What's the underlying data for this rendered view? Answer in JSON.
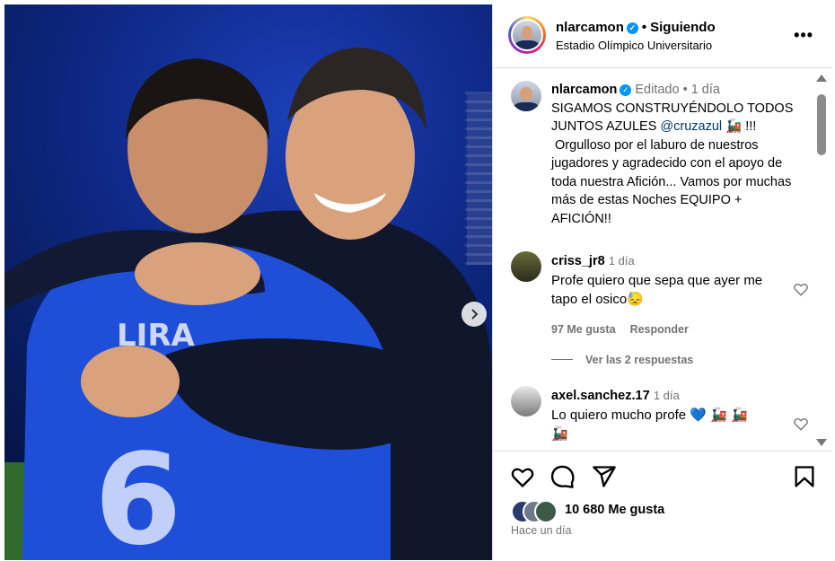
{
  "header": {
    "username": "nlarcamon",
    "follow_status": "Siguiendo",
    "location": "Estadio Olímpico Universitario",
    "more_label": "•••"
  },
  "caption": {
    "username": "nlarcamon",
    "edited": "Editado",
    "time": "1 día",
    "text_before_mention": "SIGAMOS CONSTRUYÉNDOLO TODOS JUNTOS AZULES ",
    "mention": "@cruzazul",
    "text_after_mention": " 🚂 !!!  Orgulloso por el laburo de nuestros jugadores y agradecido con el apoyo de toda nuestra Afición... Vamos por muchas más de estas Noches EQUIPO + AFICIÓN!!"
  },
  "comments": [
    {
      "username": "criss_jr8",
      "time": "1 día",
      "text": "Profe quiero que sepa que ayer me tapo el osico😓",
      "likes": "97 Me gusta",
      "reply_label": "Responder",
      "view_replies": "Ver las 2 respuestas"
    },
    {
      "username": "axel.sanchez.17",
      "time": "1 día",
      "text": "Lo quiero mucho profe 💙 🚂 🚂 🚂"
    }
  ],
  "likes_count": "10 680 Me gusta",
  "posted": "Hace un día",
  "icons": {
    "verified": "verified-badge-icon",
    "heart": "heart-icon",
    "comment": "comment-icon",
    "share": "share-icon",
    "save": "bookmark-icon",
    "next": "chevron-right-icon"
  },
  "colors": {
    "verified_blue": "#0095f6",
    "mention": "#00376b",
    "muted": "#737373",
    "border": "#dbdbdb",
    "jersey_blue": "#1f4fd8"
  }
}
